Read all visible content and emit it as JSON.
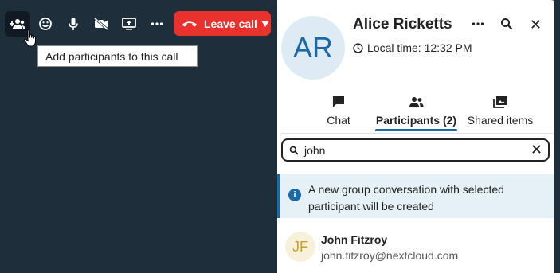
{
  "toolbar": {
    "buttons": [
      {
        "icon": "add-participants-icon"
      },
      {
        "icon": "emoji-icon"
      },
      {
        "icon": "microphone-icon"
      },
      {
        "icon": "video-off-icon"
      },
      {
        "icon": "screen-share-icon"
      },
      {
        "icon": "more-icon"
      }
    ],
    "leave_label": "Leave call",
    "leave_color": "#e9322d"
  },
  "tooltip": "Add participants to this call",
  "sidebar": {
    "avatar_initials": "AR",
    "name": "Alice Ricketts",
    "local_time": "Local time: 12:32 PM",
    "tabs": [
      {
        "label": "Chat",
        "icon": "chat-icon"
      },
      {
        "label": "Participants (2)",
        "icon": "participants-icon",
        "active": true
      },
      {
        "label": "Shared items",
        "icon": "shared-items-icon"
      }
    ],
    "search": {
      "value": "john"
    },
    "notice": "A new group conversation with selected participant will be created",
    "results": [
      {
        "initials": "JF",
        "name": "John Fitzroy",
        "email": "john.fitzroy@nextcloud.com"
      }
    ]
  },
  "colors": {
    "accent": "#1b6aa6",
    "call_background": "#1e2e3b",
    "danger": "#e9322d"
  }
}
